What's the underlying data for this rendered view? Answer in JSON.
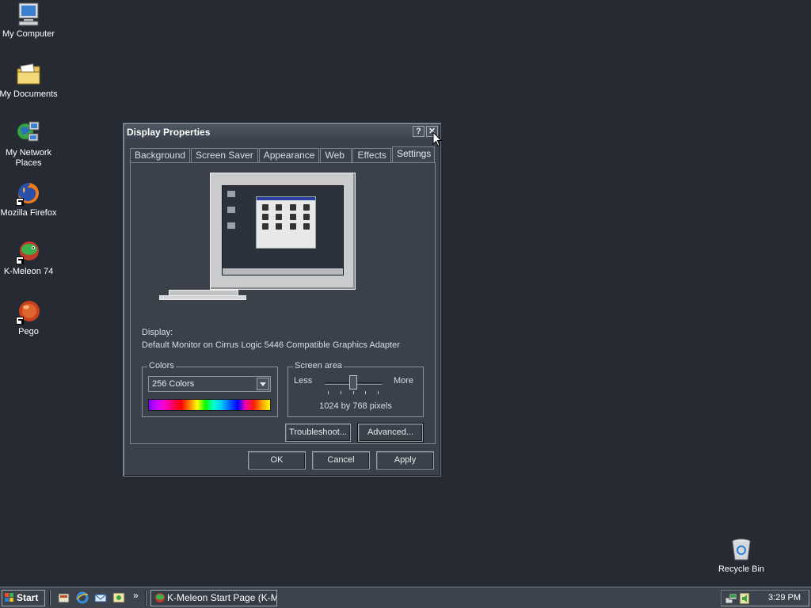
{
  "desktop": {
    "icons": [
      {
        "label": "My Computer",
        "icon": "computer-icon"
      },
      {
        "label": "My Documents",
        "icon": "folder-documents-icon"
      },
      {
        "label": "My Network Places",
        "icon": "network-icon"
      },
      {
        "label": "Mozilla Firefox",
        "icon": "firefox-icon"
      },
      {
        "label": "K-Meleon 74",
        "icon": "kmeleon-icon"
      },
      {
        "label": "Pego",
        "icon": "pego-icon"
      },
      {
        "label": "Recycle Bin",
        "icon": "recycle-bin-icon"
      }
    ]
  },
  "dialog": {
    "title": "Display Properties",
    "help_label": "?",
    "close_label": "✕",
    "tabs": [
      "Background",
      "Screen Saver",
      "Appearance",
      "Web",
      "Effects",
      "Settings"
    ],
    "active_tab": "Settings",
    "display_label": "Display:",
    "display_value": "Default Monitor on Cirrus Logic 5446 Compatible Graphics Adapter",
    "colors": {
      "legend": "Colors",
      "selected": "256 Colors"
    },
    "screen_area": {
      "legend": "Screen area",
      "less_label": "Less",
      "more_label": "More",
      "value_text": "1024 by 768 pixels",
      "slider_level_fraction": 0.5
    },
    "buttons": {
      "troubleshoot": "Troubleshoot...",
      "advanced": "Advanced...",
      "ok": "OK",
      "cancel": "Cancel",
      "apply": "Apply"
    }
  },
  "taskbar": {
    "start_label": "Start",
    "quick_launch": [
      "desktop-icon",
      "ie-icon",
      "outlook-icon",
      "media-icon"
    ],
    "overflow_label": "»",
    "task_label": "K-Meleon Start Page (K-M...",
    "clock": "3:29 PM"
  },
  "colors": {
    "desktop_bg": "#252a33",
    "dialog_bg": "#3a414b"
  }
}
